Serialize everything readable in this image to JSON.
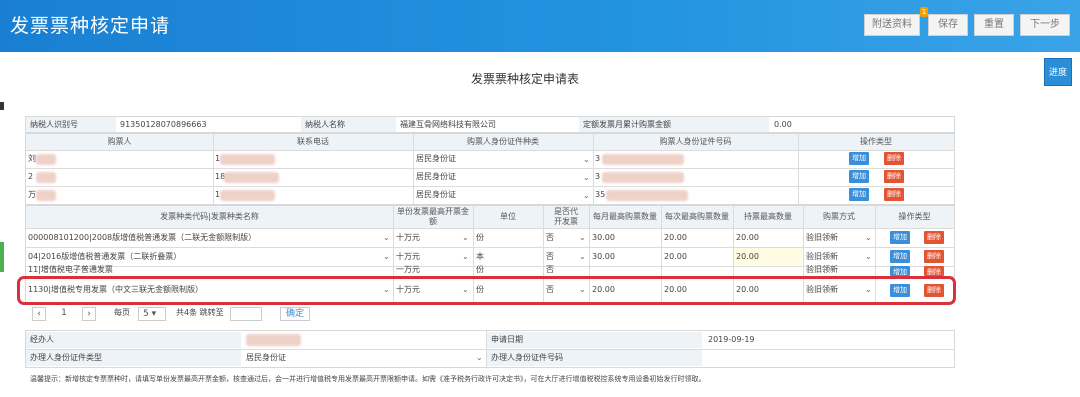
{
  "header": {
    "title": "发票票种核定申请",
    "buttons": {
      "attach": "附送资料",
      "save": "保存",
      "reset": "重置",
      "next": "下一步"
    },
    "badge": "1"
  },
  "progress_label": "进度",
  "form_title": "发票票种核定申请表",
  "taxpayer": {
    "id_label": "纳税人识别号",
    "id_value": "91350128070896663",
    "name_label": "纳税人名称",
    "name_value": "福建互骨网络科技有限公司",
    "quota_label": "定额发票月累计购票金额",
    "quota_value": "0.00"
  },
  "buyer_table": {
    "headers": [
      "购票人",
      "联系电话",
      "购票人身份证件种类",
      "购票人身份证件号码",
      "操作类型"
    ],
    "rows": [
      {
        "prefix": "刘",
        "phone_prefix": "1",
        "id_type": "居民身份证",
        "id_prefix": "3"
      },
      {
        "prefix": "2",
        "phone_prefix": "18",
        "id_type": "居民身份证",
        "id_prefix": "3"
      },
      {
        "prefix": "万",
        "phone_prefix": "1",
        "id_type": "居民身份证",
        "id_prefix": "35"
      }
    ],
    "add": "增加",
    "del": "删除"
  },
  "invoice_table": {
    "headers": [
      "发票种类代码|发票种类名称",
      "单份发票最高开票金额",
      "单位",
      "是否代开发票",
      "每月最高购票数量",
      "每次最高购票数量",
      "持票最高数量",
      "购票方式",
      "操作类型"
    ],
    "rows": [
      {
        "name": "000008101200|2008版增值税普通发票（二联无金额限制版）",
        "max": "十万元",
        "unit": "份",
        "agent": "否",
        "monthly": "30.00",
        "each": "20.00",
        "hold": "20.00",
        "method": "验旧领新"
      },
      {
        "name": "04|2016版增值税普通发票（二联折叠票）",
        "max": "十万元",
        "unit": "本",
        "agent": "否",
        "monthly": "30.00",
        "each": "20.00",
        "hold": "20.00",
        "method": "验旧领新"
      },
      {
        "name": "11|增值税电子普通发票",
        "max": "一万元",
        "unit": "份",
        "agent": "否",
        "monthly": "",
        "each": "",
        "hold": "",
        "method": "验旧领新"
      },
      {
        "name": "1130|增值税专用发票（中文三联无金额限制版）",
        "max": "十万元",
        "unit": "份",
        "agent": "否",
        "monthly": "20.00",
        "each": "20.00",
        "hold": "20.00",
        "method": "验旧领新"
      }
    ]
  },
  "pager": {
    "page": "1",
    "per_page_label": "每页",
    "per_page": "5",
    "total": "共4条 跳转至",
    "confirm": "确定"
  },
  "footer": {
    "handler_label": "经办人",
    "date_label": "申请日期",
    "date_value": "2019-09-19",
    "id_type_label": "办理人身份证件类型",
    "id_type_value": "居民身份证",
    "id_no_label": "办理人身份证件号码"
  },
  "tip": "温馨提示：新增核定专票票种时，请填写单份发票最高开票金额，核查通过后，会一并进行增值税专用发票最高开票限额申请。如需《准予税务行政许可决定书》，可在大厅进行增值税税控系统专用设备初始发行时领取。",
  "colors": {
    "header": "#1e87d6",
    "add": "#3a8fd8",
    "del": "#e25433",
    "highlight": "#d9303a"
  }
}
